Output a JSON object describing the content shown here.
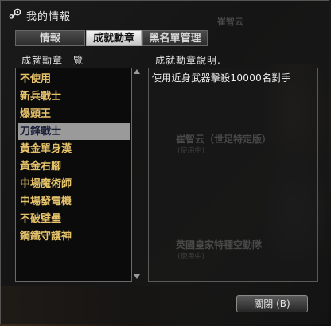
{
  "window": {
    "title": "我的情報"
  },
  "tabs": [
    {
      "label": "情報",
      "active": false
    },
    {
      "label": "成就勳章",
      "active": true
    },
    {
      "label": "黑名單管理",
      "active": false
    }
  ],
  "left_panel": {
    "header": "成就勳章一覽",
    "items": [
      "不使用",
      "新兵戰士",
      "爆頭王",
      "刀鋒戰士",
      "黃金單身漢",
      "黃金右腳",
      "中場魔術師",
      "中場發電機",
      "不破壁壘",
      "鋼鐵守護神"
    ],
    "selected_index": 3
  },
  "right_panel": {
    "header": "成就勳章說明.",
    "description": "使用近身武器擊殺10000名對手"
  },
  "background": {
    "top_name": "崔智云",
    "name1": "崔智云（世足特定版）",
    "status1": "(使用中)",
    "name2": "英國皇家特種空勤隊",
    "status2": "(使用中)"
  },
  "buttons": {
    "close": "關閉 (B)"
  },
  "icons": {
    "app": "steam-icon",
    "scroll_up": "scroll-up-arrow-icon",
    "scroll_down": "scroll-down-arrow-icon"
  },
  "colors": {
    "medal_text": "#e6c36a",
    "selection_bg": "#9a9a9a",
    "selected_text": "#1a1f3a"
  }
}
